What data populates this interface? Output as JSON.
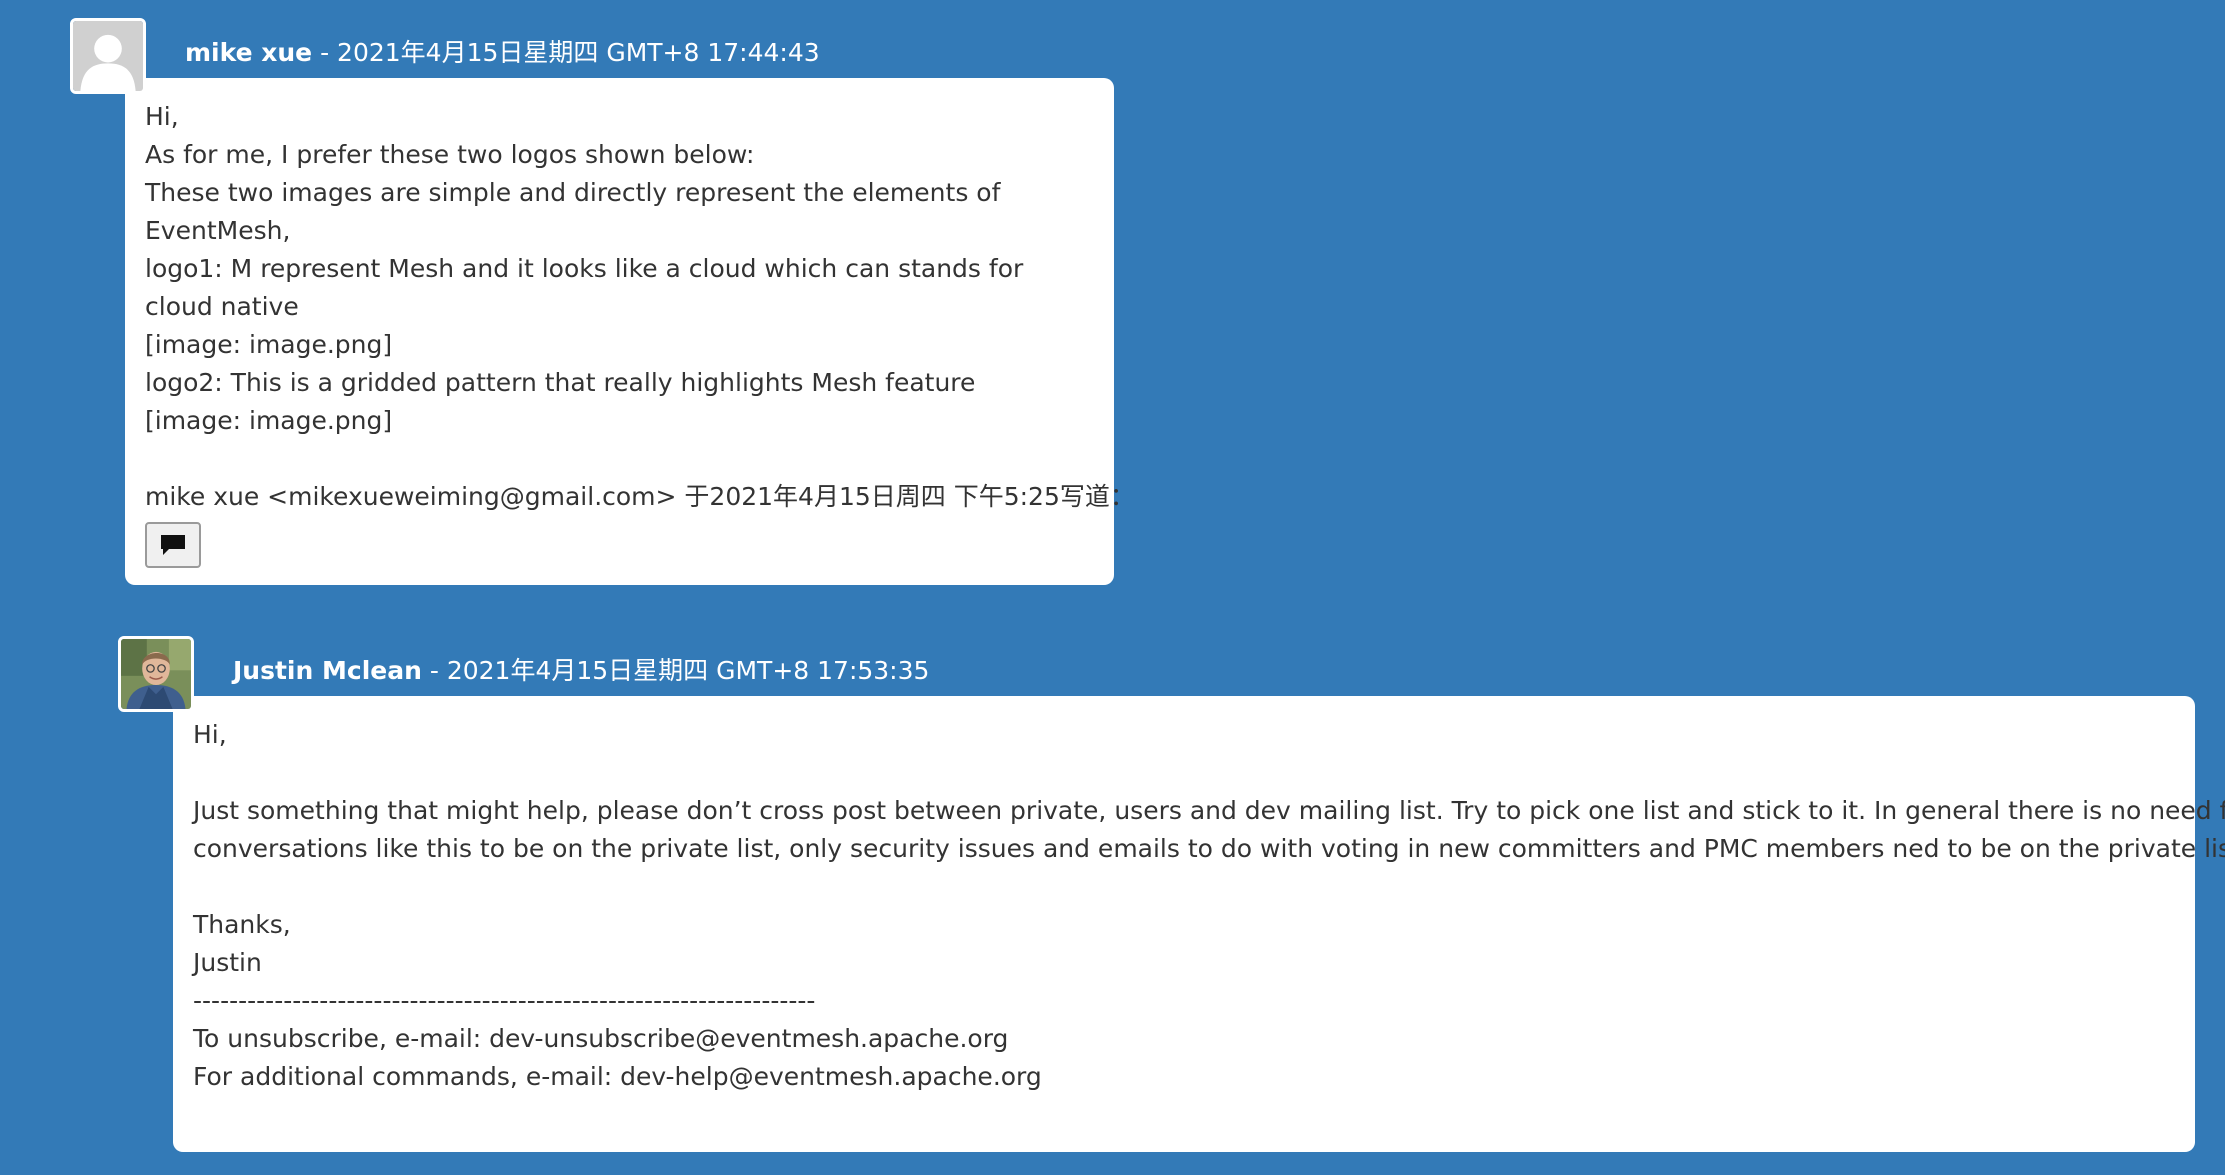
{
  "messages": [
    {
      "author": "mike xue",
      "separator": " - ",
      "date": "2021年4月15日星期四 GMT+8 17:44:43",
      "avatar_icon": "default-user-icon",
      "lines": [
        "Hi,",
        "As for me, I prefer these two logos shown below:",
        "These two images are simple and directly represent the elements of",
        "EventMesh,",
        "logo1: M represent Mesh and it looks like a cloud which can stands for",
        "cloud native",
        "[image: image.png]",
        "logo2: This is a gridded pattern that really highlights Mesh feature",
        "[image: image.png]",
        "",
        "mike xue <mikexueweiming@gmail.com> 于2021年4月15日周四 下午5:25写道："
      ],
      "quote_button_icon": "speech-bubble-icon"
    },
    {
      "author": "Justin Mclean",
      "separator": " - ",
      "date": "2021年4月15日星期四 GMT+8 17:53:35",
      "avatar_icon": "user-photo",
      "lines": [
        "Hi,",
        "",
        "Just something that might help, please don’t cross post between private, users and dev mailing list. Try to pick one list and stick to it. In general there is no need for",
        "conversations like this to be on the private list, only security issues and emails to do with voting in new committers and PMC members ned to be on the private list.",
        "",
        "Thanks,",
        "Justin",
        "---------------------------------------------------------------------",
        "To unsubscribe, e-mail: dev-unsubscribe@eventmesh.apache.org",
        "For additional commands, e-mail: dev-help@eventmesh.apache.org"
      ]
    }
  ],
  "colors": {
    "background": "#337ab7",
    "bubble": "#ffffff",
    "text": "#333333"
  }
}
